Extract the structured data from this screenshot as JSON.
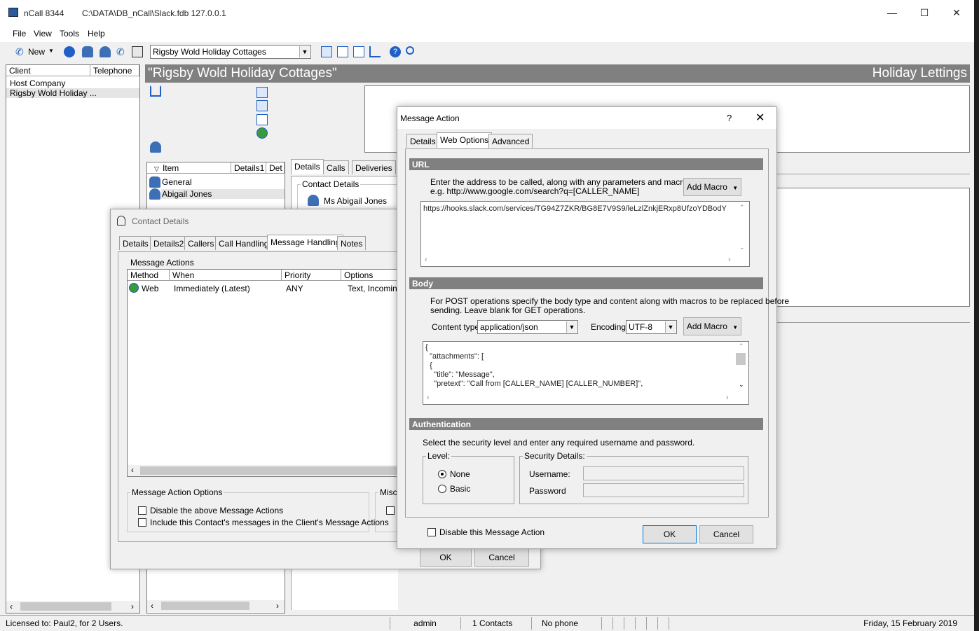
{
  "main_window": {
    "app_title": "nCall 8344",
    "path": "C:\\DATA\\DB_nCall\\Slack.fdb 127.0.0.1",
    "menu": [
      "File",
      "View",
      "Tools",
      "Help"
    ],
    "toolbar": {
      "new_label": "New",
      "client_select": "Rigsby Wold Holiday Cottages"
    }
  },
  "client_list": {
    "headers": [
      "Client",
      "Telephone"
    ],
    "items": [
      "Host Company",
      "Rigsby Wold Holiday ..."
    ]
  },
  "client_header": {
    "name": "\"Rigsby Wold Holiday Cottages\"",
    "category": "Holiday Lettings"
  },
  "item_list": {
    "headers": [
      "Item",
      "Details1",
      "Det"
    ],
    "items": [
      "General",
      "Abigail Jones"
    ]
  },
  "detail_tabs": [
    "Details",
    "Calls",
    "Deliveries"
  ],
  "contact_details_group": {
    "label": "Contact Details",
    "name": "Ms Abigail Jones"
  },
  "contact_dialog": {
    "title": "Contact Details",
    "tabs": [
      "Details",
      "Details2",
      "Callers",
      "Call Handling",
      "Message Handling",
      "Notes"
    ],
    "selected_tab": "Message Handling",
    "message_actions_label": "Message Actions",
    "columns": [
      "Method",
      "When",
      "Priority",
      "Options"
    ],
    "rows": [
      {
        "method": "Web",
        "when": "Immediately (Latest)",
        "priority": "ANY",
        "options": "Text, Incoming"
      }
    ],
    "options_group": "Message Action Options",
    "misc_group": "Misc",
    "checkbox1": "Disable the above Message Actions",
    "checkbox2": "Include this Contact's messages in the Client's Message Actions",
    "ok": "OK",
    "cancel": "Cancel"
  },
  "message_action": {
    "title": "Message Action",
    "help": "?",
    "tabs": [
      "Details",
      "Web Options",
      "Advanced"
    ],
    "selected_tab": "Web Options",
    "url_section": "URL",
    "url_help1": "Enter the address to be called, along with any parameters and macros",
    "url_help2": "e.g. http://www.google.com/search?q=[CALLER_NAME]",
    "add_macro": "Add Macro",
    "url_value": "https://hooks.slack.com/services/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",
    "body_section": "Body",
    "body_help1": "For POST operations specify the body type and content along with macros to be replaced before",
    "body_help2": "sending.  Leave blank for GET operations.",
    "content_type_label": "Content type:",
    "content_type": "application/json",
    "encoding_label": "Encoding:",
    "encoding": "UTF-8",
    "body_lines": [
      "{",
      "  \"attachments\": [",
      "  {",
      "    \"title\": \"Message\",",
      "    \"pretext\": \"Call from [CALLER_NAME] [CALLER_NUMBER]\","
    ],
    "auth_section": "Authentication",
    "auth_help": "Select the security level and enter any required username and password.",
    "level_group": "Level:",
    "level_none": "None",
    "level_basic": "Basic",
    "security_group": "Security Details:",
    "username_label": "Username:",
    "password_label": "Password",
    "disable_label": "Disable this Message Action",
    "ok": "OK",
    "cancel": "Cancel"
  },
  "status_bar": {
    "license": "Licensed to: Paul2, for 2 Users.",
    "user": "admin",
    "contacts": "1 Contacts",
    "phone": "No phone",
    "date": "Friday, 15 February 2019"
  }
}
